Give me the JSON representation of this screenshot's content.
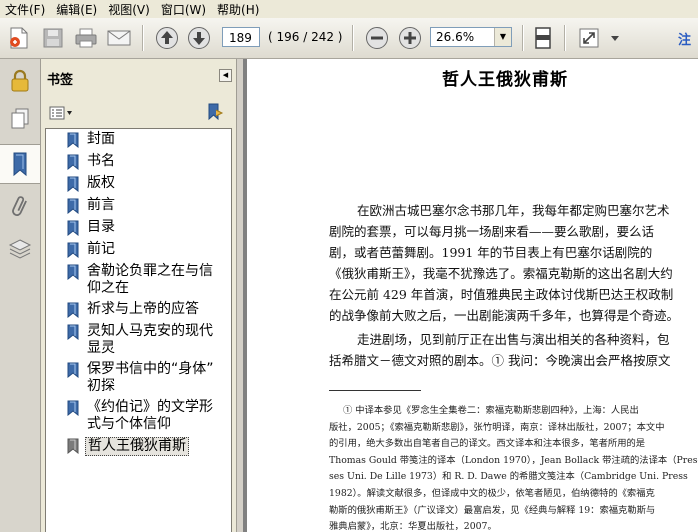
{
  "menu": [
    "文件(F)",
    "编辑(E)",
    "视图(V)",
    "窗口(W)",
    "帮助(H)"
  ],
  "toolbar": {
    "page_current": "189",
    "page_count": "( 196 / 242 )",
    "zoom": "26.6%",
    "overflow_text": "注"
  },
  "panel": {
    "title": "书签"
  },
  "bookmarks": [
    {
      "lines": [
        "封面"
      ]
    },
    {
      "lines": [
        "书名"
      ]
    },
    {
      "lines": [
        "版权"
      ]
    },
    {
      "lines": [
        "前言"
      ]
    },
    {
      "lines": [
        "目录"
      ]
    },
    {
      "lines": [
        "前记"
      ]
    },
    {
      "lines": [
        "舍勒论负罪之在与信",
        "仰之在"
      ]
    },
    {
      "lines": [
        "祈求与上帝的应答"
      ]
    },
    {
      "lines": [
        "灵知人马克安的现代",
        "显灵"
      ]
    },
    {
      "lines": [
        "保罗书信中的“身体”",
        "初探"
      ]
    },
    {
      "lines": [
        "《约伯记》的文学形",
        "式与个体信仰"
      ]
    },
    {
      "lines": [
        "哲人王俄狄甫斯"
      ],
      "selected": true
    }
  ],
  "document": {
    "title": "哲人王俄狄甫斯",
    "body_lines": [
      "在欧洲古城巴塞尔念书那几年，我每年都定购巴塞尔艺术",
      "剧院的套票，可以每月挑一场剧来看——要么歌剧，要么话",
      "剧，或者芭蕾舞剧。1991 年的节目表上有巴塞尔话剧院的",
      "《俄狄甫斯王》，我毫不犹豫选了。索福克勒斯的这出名剧大约",
      "在公元前 429 年首演，时值雅典民主政体讨伐斯巴达王权政制",
      "的战争像前大败之后，一出剧能演两千多年，也算得是个奇迹。",
      "走进剧场，见到前厅正在出售与演出相关的各种资料，包",
      "括希腊文－德文对照的剧本。① 我问：今晚演出会严格按原文"
    ],
    "footnote_lines": [
      "①  中译本参见《罗念生全集卷二：索福克勒斯悲剧四种》，上海：人民出",
      "版社，2005；《索福克勒斯悲剧》，张竹明译，南京：译林出版社，2007；本文中",
      "的引用，绝大多数出自笔者自己的译文。西文译本和注本很多，笔者所用的是",
      "Thomas Gould 带笺注的译本（London 1970），Jean Bollack 带注疏的法译本（Pres-",
      "ses Uni. De Lille 1973）和 R. D. Dawe 的希腊文笺注本（Cambridge Uni. Press",
      "1982）。解读文献很多，但译成中文的极少，依笔者陋见，伯纳德特的《索福克",
      "勒斯的俄狄甫斯王》（广议译文）最富启发，见《经典与解释 19：索福克勒斯与",
      "雅典启蒙》，北京：华夏出版社，2007。"
    ]
  }
}
